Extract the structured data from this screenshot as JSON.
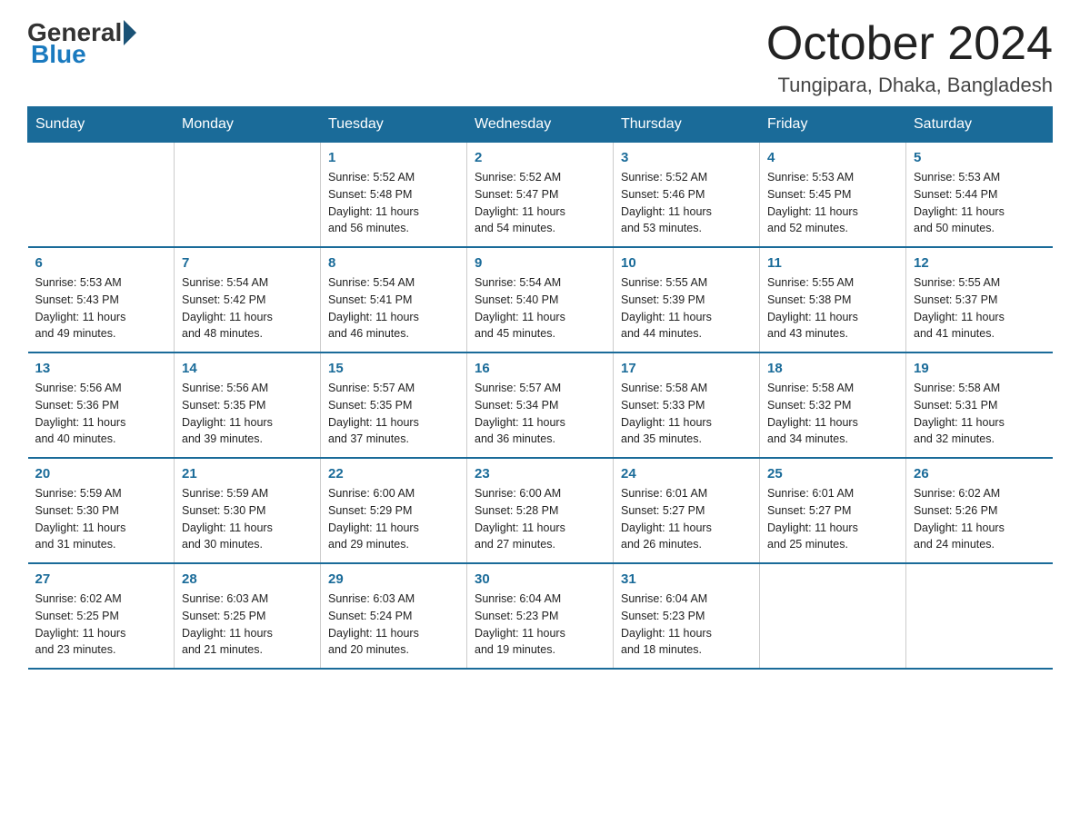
{
  "logo": {
    "general": "General",
    "blue": "Blue"
  },
  "header": {
    "month": "October 2024",
    "location": "Tungipara, Dhaka, Bangladesh"
  },
  "weekdays": [
    "Sunday",
    "Monday",
    "Tuesday",
    "Wednesday",
    "Thursday",
    "Friday",
    "Saturday"
  ],
  "weeks": [
    [
      {
        "day": "",
        "info": ""
      },
      {
        "day": "",
        "info": ""
      },
      {
        "day": "1",
        "info": "Sunrise: 5:52 AM\nSunset: 5:48 PM\nDaylight: 11 hours\nand 56 minutes."
      },
      {
        "day": "2",
        "info": "Sunrise: 5:52 AM\nSunset: 5:47 PM\nDaylight: 11 hours\nand 54 minutes."
      },
      {
        "day": "3",
        "info": "Sunrise: 5:52 AM\nSunset: 5:46 PM\nDaylight: 11 hours\nand 53 minutes."
      },
      {
        "day": "4",
        "info": "Sunrise: 5:53 AM\nSunset: 5:45 PM\nDaylight: 11 hours\nand 52 minutes."
      },
      {
        "day": "5",
        "info": "Sunrise: 5:53 AM\nSunset: 5:44 PM\nDaylight: 11 hours\nand 50 minutes."
      }
    ],
    [
      {
        "day": "6",
        "info": "Sunrise: 5:53 AM\nSunset: 5:43 PM\nDaylight: 11 hours\nand 49 minutes."
      },
      {
        "day": "7",
        "info": "Sunrise: 5:54 AM\nSunset: 5:42 PM\nDaylight: 11 hours\nand 48 minutes."
      },
      {
        "day": "8",
        "info": "Sunrise: 5:54 AM\nSunset: 5:41 PM\nDaylight: 11 hours\nand 46 minutes."
      },
      {
        "day": "9",
        "info": "Sunrise: 5:54 AM\nSunset: 5:40 PM\nDaylight: 11 hours\nand 45 minutes."
      },
      {
        "day": "10",
        "info": "Sunrise: 5:55 AM\nSunset: 5:39 PM\nDaylight: 11 hours\nand 44 minutes."
      },
      {
        "day": "11",
        "info": "Sunrise: 5:55 AM\nSunset: 5:38 PM\nDaylight: 11 hours\nand 43 minutes."
      },
      {
        "day": "12",
        "info": "Sunrise: 5:55 AM\nSunset: 5:37 PM\nDaylight: 11 hours\nand 41 minutes."
      }
    ],
    [
      {
        "day": "13",
        "info": "Sunrise: 5:56 AM\nSunset: 5:36 PM\nDaylight: 11 hours\nand 40 minutes."
      },
      {
        "day": "14",
        "info": "Sunrise: 5:56 AM\nSunset: 5:35 PM\nDaylight: 11 hours\nand 39 minutes."
      },
      {
        "day": "15",
        "info": "Sunrise: 5:57 AM\nSunset: 5:35 PM\nDaylight: 11 hours\nand 37 minutes."
      },
      {
        "day": "16",
        "info": "Sunrise: 5:57 AM\nSunset: 5:34 PM\nDaylight: 11 hours\nand 36 minutes."
      },
      {
        "day": "17",
        "info": "Sunrise: 5:58 AM\nSunset: 5:33 PM\nDaylight: 11 hours\nand 35 minutes."
      },
      {
        "day": "18",
        "info": "Sunrise: 5:58 AM\nSunset: 5:32 PM\nDaylight: 11 hours\nand 34 minutes."
      },
      {
        "day": "19",
        "info": "Sunrise: 5:58 AM\nSunset: 5:31 PM\nDaylight: 11 hours\nand 32 minutes."
      }
    ],
    [
      {
        "day": "20",
        "info": "Sunrise: 5:59 AM\nSunset: 5:30 PM\nDaylight: 11 hours\nand 31 minutes."
      },
      {
        "day": "21",
        "info": "Sunrise: 5:59 AM\nSunset: 5:30 PM\nDaylight: 11 hours\nand 30 minutes."
      },
      {
        "day": "22",
        "info": "Sunrise: 6:00 AM\nSunset: 5:29 PM\nDaylight: 11 hours\nand 29 minutes."
      },
      {
        "day": "23",
        "info": "Sunrise: 6:00 AM\nSunset: 5:28 PM\nDaylight: 11 hours\nand 27 minutes."
      },
      {
        "day": "24",
        "info": "Sunrise: 6:01 AM\nSunset: 5:27 PM\nDaylight: 11 hours\nand 26 minutes."
      },
      {
        "day": "25",
        "info": "Sunrise: 6:01 AM\nSunset: 5:27 PM\nDaylight: 11 hours\nand 25 minutes."
      },
      {
        "day": "26",
        "info": "Sunrise: 6:02 AM\nSunset: 5:26 PM\nDaylight: 11 hours\nand 24 minutes."
      }
    ],
    [
      {
        "day": "27",
        "info": "Sunrise: 6:02 AM\nSunset: 5:25 PM\nDaylight: 11 hours\nand 23 minutes."
      },
      {
        "day": "28",
        "info": "Sunrise: 6:03 AM\nSunset: 5:25 PM\nDaylight: 11 hours\nand 21 minutes."
      },
      {
        "day": "29",
        "info": "Sunrise: 6:03 AM\nSunset: 5:24 PM\nDaylight: 11 hours\nand 20 minutes."
      },
      {
        "day": "30",
        "info": "Sunrise: 6:04 AM\nSunset: 5:23 PM\nDaylight: 11 hours\nand 19 minutes."
      },
      {
        "day": "31",
        "info": "Sunrise: 6:04 AM\nSunset: 5:23 PM\nDaylight: 11 hours\nand 18 minutes."
      },
      {
        "day": "",
        "info": ""
      },
      {
        "day": "",
        "info": ""
      }
    ]
  ]
}
